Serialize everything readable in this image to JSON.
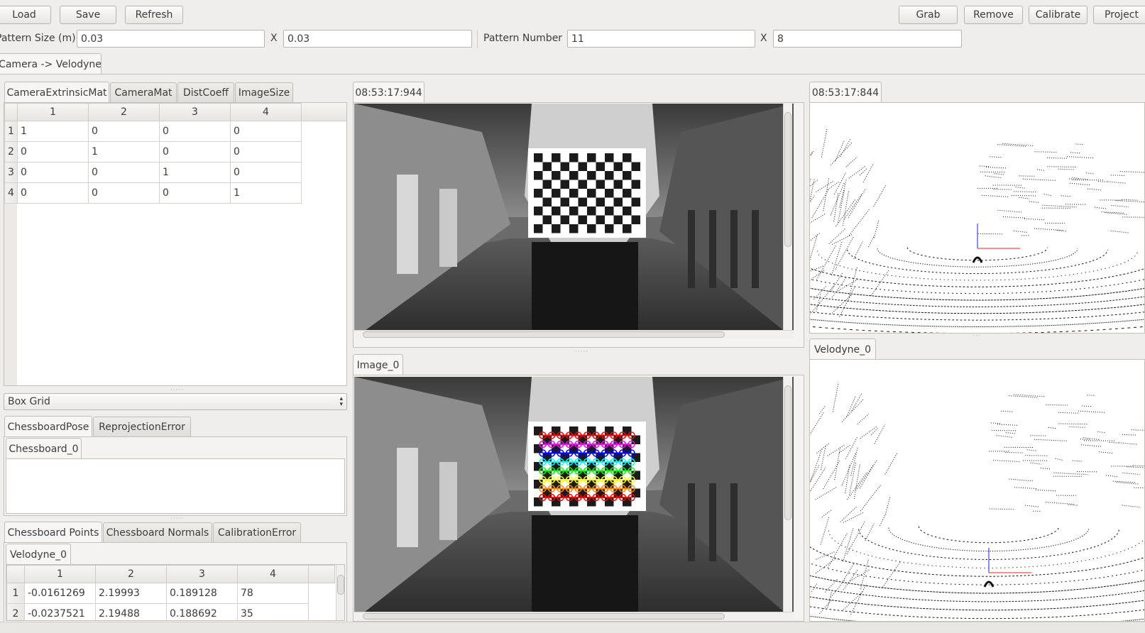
{
  "toolbar": {
    "load": "Load",
    "save": "Save",
    "refresh": "Refresh",
    "grab": "Grab",
    "remove": "Remove",
    "calibrate": "Calibrate",
    "project": "Project"
  },
  "pattern": {
    "size_label": "Pattern Size (m)",
    "size_x": "0.03",
    "x_sep": "X",
    "size_y": "0.03",
    "number_label": "Pattern Number",
    "number_x": "11",
    "number_sep": "X",
    "number_y": "8"
  },
  "main_tab": "Camera -> Velodyne",
  "matrix_tabs": [
    "CameraExtrinsicMat",
    "CameraMat",
    "DistCoeff",
    "ImageSize"
  ],
  "matrix": {
    "columns": [
      "1",
      "2",
      "3",
      "4"
    ],
    "rows": [
      {
        "head": "1",
        "cells": [
          "1",
          "0",
          "0",
          "0"
        ]
      },
      {
        "head": "2",
        "cells": [
          "0",
          "1",
          "0",
          "0"
        ]
      },
      {
        "head": "3",
        "cells": [
          "0",
          "0",
          "1",
          "0"
        ]
      },
      {
        "head": "4",
        "cells": [
          "0",
          "0",
          "0",
          "1"
        ]
      }
    ]
  },
  "grid_select": "Box Grid",
  "pose_tabs": [
    "ChessboardPose",
    "ReprojectionError"
  ],
  "pose_subtab": "Chessboard_0",
  "points_tabs": [
    "Chessboard Points",
    "Chessboard Normals",
    "CalibrationError"
  ],
  "points_subtab": "Velodyne_0",
  "points": {
    "columns": [
      "1",
      "2",
      "3",
      "4"
    ],
    "rows": [
      {
        "head": "1",
        "cells": [
          "-0.0161269",
          "2.19993",
          "0.189128",
          "78"
        ]
      },
      {
        "head": "2",
        "cells": [
          "-0.0237521",
          "2.19488",
          "0.188692",
          "35"
        ]
      }
    ]
  },
  "image_top_tab": "08:53:17:944",
  "image_bottom_tab": "Image_0",
  "velo_top_tab": "08:53:17:844",
  "velo_bottom_tab": "Velodyne_0",
  "colors": {
    "window_bg": "#efeeec",
    "corner_rows": [
      "#ff0000",
      "#ff00ff",
      "#0000ff",
      "#00ffff",
      "#00ff00",
      "#ffff00",
      "#ff8800",
      "#ff0000"
    ]
  }
}
